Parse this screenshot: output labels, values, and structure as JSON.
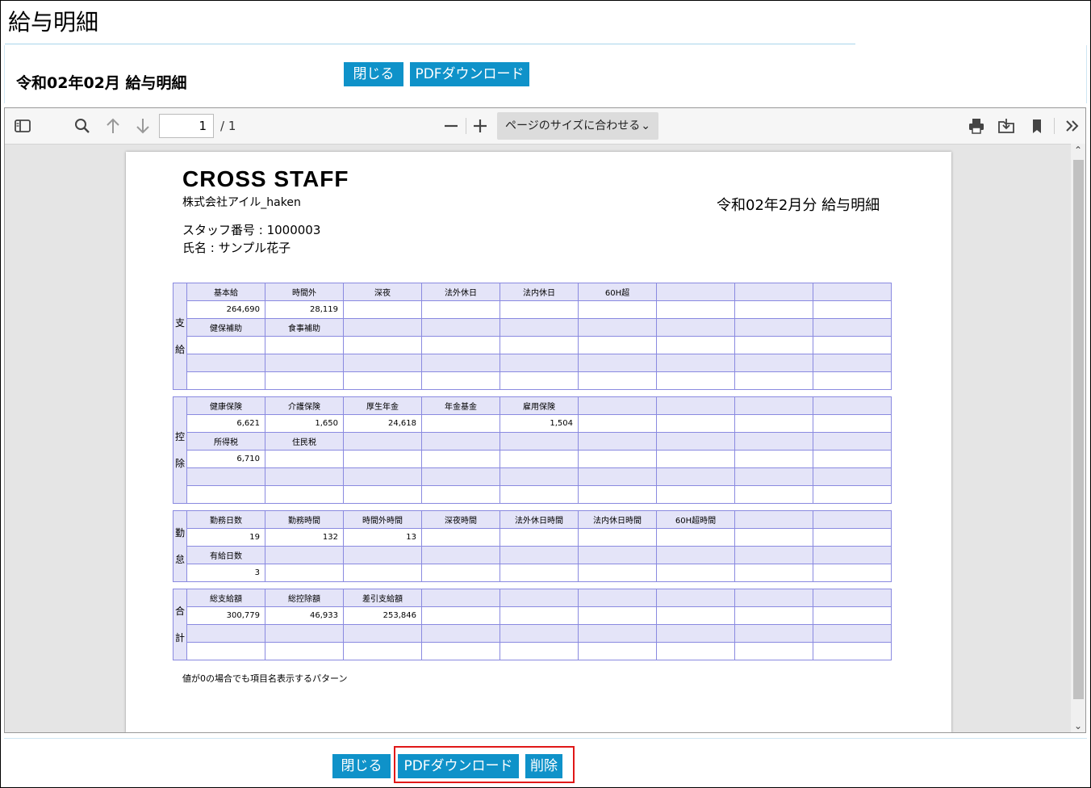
{
  "page": {
    "title": "給与明細"
  },
  "header": {
    "subtitle": "令和02年02月 給与明細",
    "close_label": "閉じる",
    "pdf_label": "PDFダウンロード"
  },
  "viewer": {
    "page_input": "1",
    "page_count": "/ 1",
    "zoom_label": "ページのサイズに合わせる",
    "icons": [
      "sidebar-toggle-icon",
      "search-icon",
      "arrow-up-icon",
      "arrow-down-icon",
      "zoom-out-icon",
      "zoom-in-icon",
      "print-icon",
      "save-icon",
      "bookmark-icon",
      "more-tools-icon"
    ]
  },
  "document": {
    "logo": "CROSS STAFF",
    "company": "株式会社アイル_haken",
    "title": "令和02年2月分 給与明細",
    "staff_no": "スタッフ番号 : 1000003",
    "staff_name": "氏名 : サンプル花子",
    "note": "値が0の場合でも項目名表示するパターン",
    "sections": [
      {
        "side": [
          "支",
          "給"
        ],
        "rows": [
          {
            "labels": [
              "基本給",
              "時間外",
              "深夜",
              "法外休日",
              "法内休日",
              "60H超",
              "",
              "",
              ""
            ],
            "values": [
              "264,690",
              "28,119",
              "",
              "",
              "",
              "",
              "",
              "",
              ""
            ]
          },
          {
            "labels": [
              "健保補助",
              "食事補助",
              "",
              "",
              "",
              "",
              "",
              "",
              ""
            ],
            "values": [
              "",
              "",
              "",
              "",
              "",
              "",
              "",
              "",
              ""
            ]
          },
          {
            "labels": [
              "",
              "",
              "",
              "",
              "",
              "",
              "",
              "",
              ""
            ],
            "values": [
              "",
              "",
              "",
              "",
              "",
              "",
              "",
              "",
              ""
            ]
          }
        ]
      },
      {
        "side": [
          "控",
          "除"
        ],
        "rows": [
          {
            "labels": [
              "健康保険",
              "介護保険",
              "厚生年金",
              "年金基金",
              "雇用保険",
              "",
              "",
              "",
              ""
            ],
            "values": [
              "6,621",
              "1,650",
              "24,618",
              "",
              "1,504",
              "",
              "",
              "",
              ""
            ]
          },
          {
            "labels": [
              "所得税",
              "住民税",
              "",
              "",
              "",
              "",
              "",
              "",
              ""
            ],
            "values": [
              "6,710",
              "",
              "",
              "",
              "",
              "",
              "",
              "",
              ""
            ]
          },
          {
            "labels": [
              "",
              "",
              "",
              "",
              "",
              "",
              "",
              "",
              ""
            ],
            "values": [
              "",
              "",
              "",
              "",
              "",
              "",
              "",
              "",
              ""
            ]
          }
        ]
      },
      {
        "side": [
          "勤",
          "怠"
        ],
        "rows": [
          {
            "labels": [
              "勤務日数",
              "勤務時間",
              "時間外時間",
              "深夜時間",
              "法外休日時間",
              "法内休日時間",
              "60H超時間",
              "",
              ""
            ],
            "values": [
              "19",
              "132",
              "13",
              "",
              "",
              "",
              "",
              "",
              ""
            ]
          },
          {
            "labels": [
              "有給日数",
              "",
              "",
              "",
              "",
              "",
              "",
              "",
              ""
            ],
            "values": [
              "3",
              "",
              "",
              "",
              "",
              "",
              "",
              "",
              ""
            ]
          }
        ]
      },
      {
        "side": [
          "合",
          "計"
        ],
        "rows": [
          {
            "labels": [
              "総支給額",
              "総控除額",
              "差引支給額",
              "",
              "",
              "",
              "",
              "",
              ""
            ],
            "values": [
              "300,779",
              "46,933",
              "253,846",
              "",
              "",
              "",
              "",
              "",
              ""
            ]
          },
          {
            "labels": [
              "",
              "",
              "",
              "",
              "",
              "",
              "",
              "",
              ""
            ],
            "values": [
              "",
              "",
              "",
              "",
              "",
              "",
              "",
              "",
              ""
            ]
          }
        ]
      }
    ]
  },
  "footer": {
    "close_label": "閉じる",
    "pdf_label": "PDFダウンロード",
    "delete_label": "削除"
  }
}
